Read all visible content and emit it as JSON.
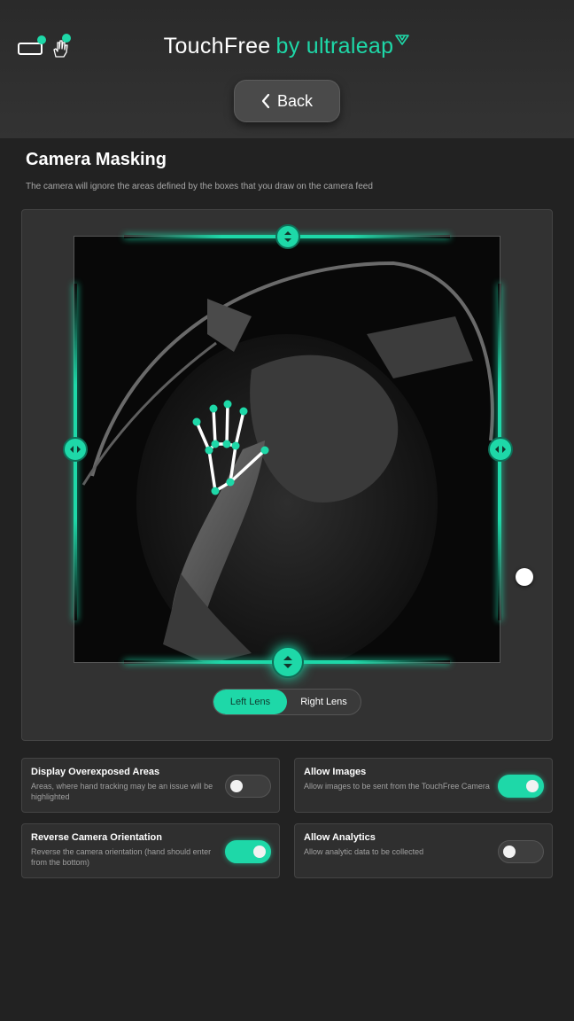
{
  "header": {
    "app_name": "TouchFree",
    "by_text": "by ultraleap",
    "back_label": "Back",
    "icons": [
      "camera-status-icon",
      "hand-status-icon",
      "chevron-left-icon"
    ]
  },
  "section": {
    "title": "Camera Masking",
    "subtitle": "The camera will ignore the areas defined by the boxes that you draw on the camera feed"
  },
  "lens": {
    "options": [
      "Left Lens",
      "Right Lens"
    ],
    "selected": "Left Lens"
  },
  "settings": [
    {
      "title": "Display Overexposed Areas",
      "description": "Areas, where hand tracking may be an issue will be highlighted",
      "enabled": false
    },
    {
      "title": "Allow Images",
      "description": "Allow images to be sent from the TouchFree Camera",
      "enabled": true
    },
    {
      "title": "Reverse Camera Orientation",
      "description": "Reverse the camera orientation (hand should enter from the bottom)",
      "enabled": true
    },
    {
      "title": "Allow Analytics",
      "description": "Allow analytic data to be collected",
      "enabled": false
    }
  ],
  "colors": {
    "accent": "#1ed8a8",
    "background": "#222222",
    "panel": "#323232"
  }
}
